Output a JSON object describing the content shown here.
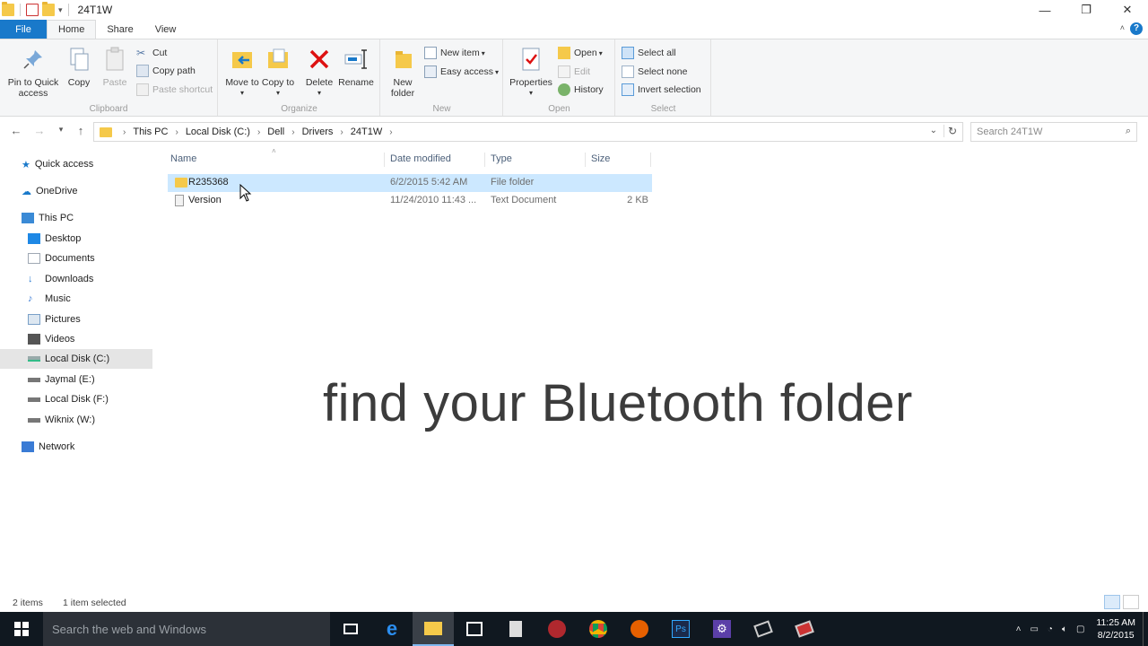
{
  "window": {
    "title": "24T1W",
    "controls": [
      "—",
      "❐",
      "✕"
    ]
  },
  "tabs": [
    "File",
    "Home",
    "Share",
    "View"
  ],
  "ribbon": {
    "clipboard": {
      "label": "Clipboard",
      "pin": "Pin to Quick access",
      "copy": "Copy",
      "paste": "Paste",
      "cut": "Cut",
      "copy_path": "Copy path",
      "paste_shortcut": "Paste shortcut"
    },
    "organize": {
      "label": "Organize",
      "move_to": "Move to",
      "copy_to": "Copy to",
      "delete": "Delete",
      "rename": "Rename"
    },
    "new": {
      "label": "New",
      "new_folder": "New folder",
      "new_item": "New item",
      "easy_access": "Easy access"
    },
    "open": {
      "label": "Open",
      "properties": "Properties",
      "open": "Open",
      "edit": "Edit",
      "history": "History"
    },
    "select": {
      "label": "Select",
      "select_all": "Select all",
      "select_none": "Select none",
      "invert": "Invert selection"
    }
  },
  "address": {
    "crumbs": [
      "This PC",
      "Local Disk (C:)",
      "Dell",
      "Drivers",
      "24T1W"
    ],
    "search_placeholder": "Search 24T1W"
  },
  "nav": {
    "items": [
      {
        "label": "Quick access",
        "icon": "star-icon",
        "color": "#1979ca"
      },
      {
        "label": "OneDrive",
        "icon": "cloud-icon",
        "color": "#1979ca"
      },
      {
        "label": "This PC",
        "icon": "computer-icon",
        "color": "#3a8ad6"
      },
      {
        "label": "Desktop",
        "icon": "desktop-icon",
        "color": "#1e88e5"
      },
      {
        "label": "Documents",
        "icon": "documents-icon",
        "color": "#9fa8b3"
      },
      {
        "label": "Downloads",
        "icon": "download-icon",
        "color": "#2a7bd1"
      },
      {
        "label": "Music",
        "icon": "music-icon",
        "color": "#3a7bd5"
      },
      {
        "label": "Pictures",
        "icon": "pictures-icon",
        "color": "#7aa0c8"
      },
      {
        "label": "Videos",
        "icon": "videos-icon",
        "color": "#555"
      },
      {
        "label": "Local Disk (C:)",
        "icon": "drive-icon",
        "color": "#666"
      },
      {
        "label": "Jaymal (E:)",
        "icon": "drive-icon",
        "color": "#666"
      },
      {
        "label": "Local Disk (F:)",
        "icon": "drive-icon",
        "color": "#666"
      },
      {
        "label": "Wiknix (W:)",
        "icon": "drive-icon",
        "color": "#666"
      },
      {
        "label": "Network",
        "icon": "network-icon",
        "color": "#3a7bd5"
      }
    ]
  },
  "columns": {
    "name": "Name",
    "date": "Date modified",
    "type": "Type",
    "size": "Size"
  },
  "files": [
    {
      "name": "R235368",
      "date": "6/2/2015 5:42 AM",
      "type": "File folder",
      "size": ""
    },
    {
      "name": "Version",
      "date": "11/24/2010 11:43 ...",
      "type": "Text Document",
      "size": "2 KB"
    }
  ],
  "caption": "find your Bluetooth folder",
  "status": {
    "items": "2 items",
    "selected": "1 item selected"
  },
  "taskbar": {
    "search_placeholder": "Search the web and Windows",
    "time": "11:25 AM",
    "date": "8/2/2015"
  },
  "colors": {
    "accent": "#1979ca",
    "selection": "#cce8ff",
    "folder": "#f5c94a",
    "delete_red": "#d11"
  }
}
